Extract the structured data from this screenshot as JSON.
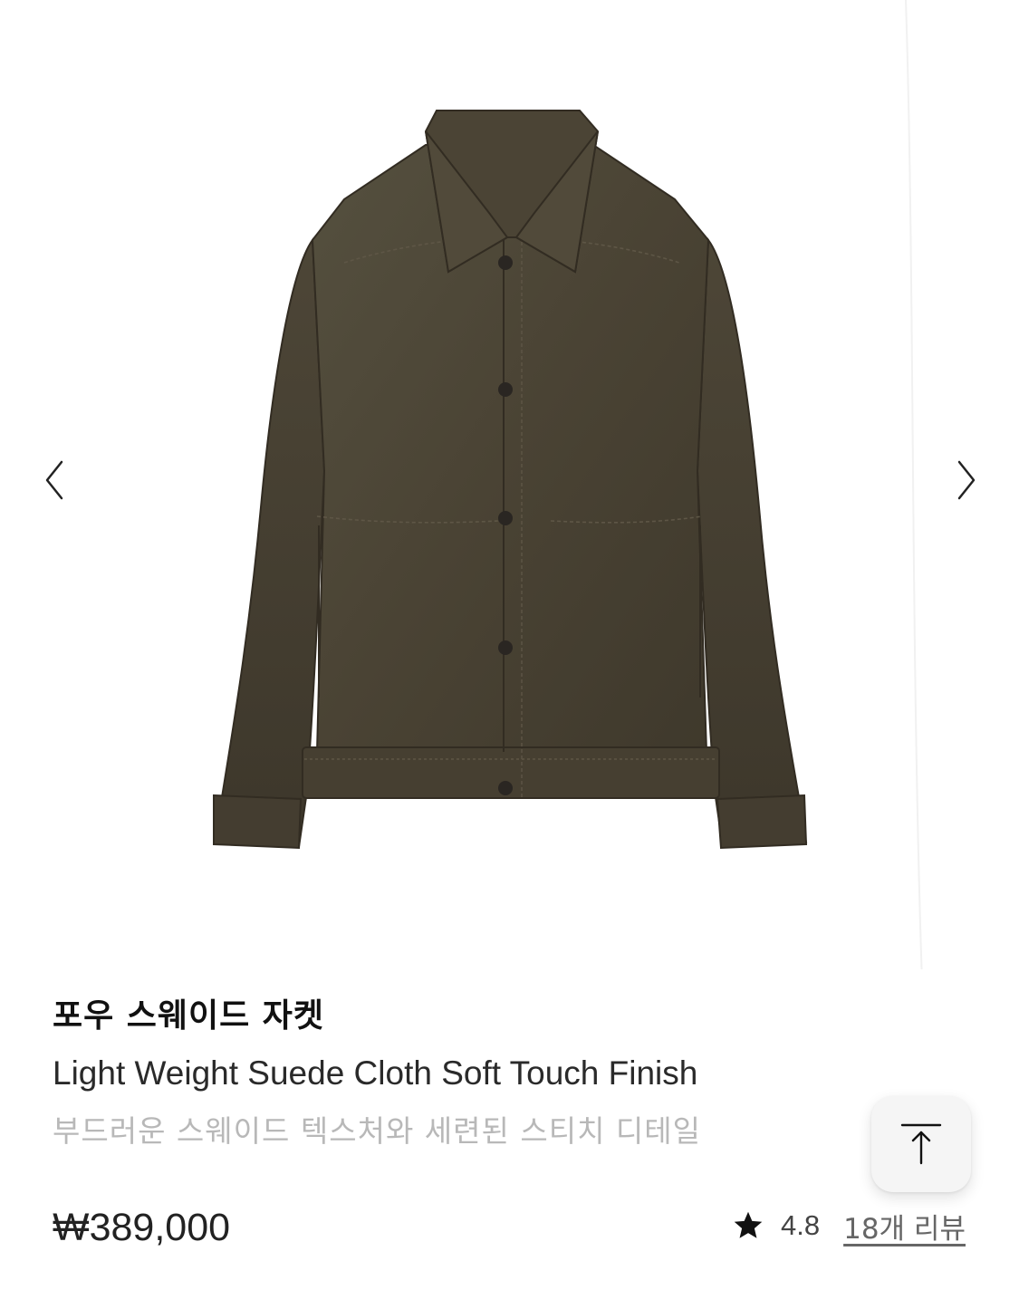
{
  "gallery": {
    "prev_icon": "chevron-left-icon",
    "next_icon": "chevron-right-icon",
    "image_alt": "포우 스웨이드 자켓"
  },
  "product": {
    "title": "포우 스웨이드 자켓",
    "subtitle_en": "Light Weight Suede Cloth Soft Touch Finish",
    "subtitle_ko": "부드러운 스웨이드 텍스처와 세련된 스티치 디테일",
    "price": "₩389,000",
    "rating": "4.8",
    "review_link": "18개 리뷰"
  },
  "scroll_top": {
    "icon": "arrow-to-top-icon"
  },
  "colors": {
    "jacket": "#4a4234",
    "title": "#111111",
    "muted_text": "#b8b8b8",
    "button_bg": "#f5f5f5"
  }
}
